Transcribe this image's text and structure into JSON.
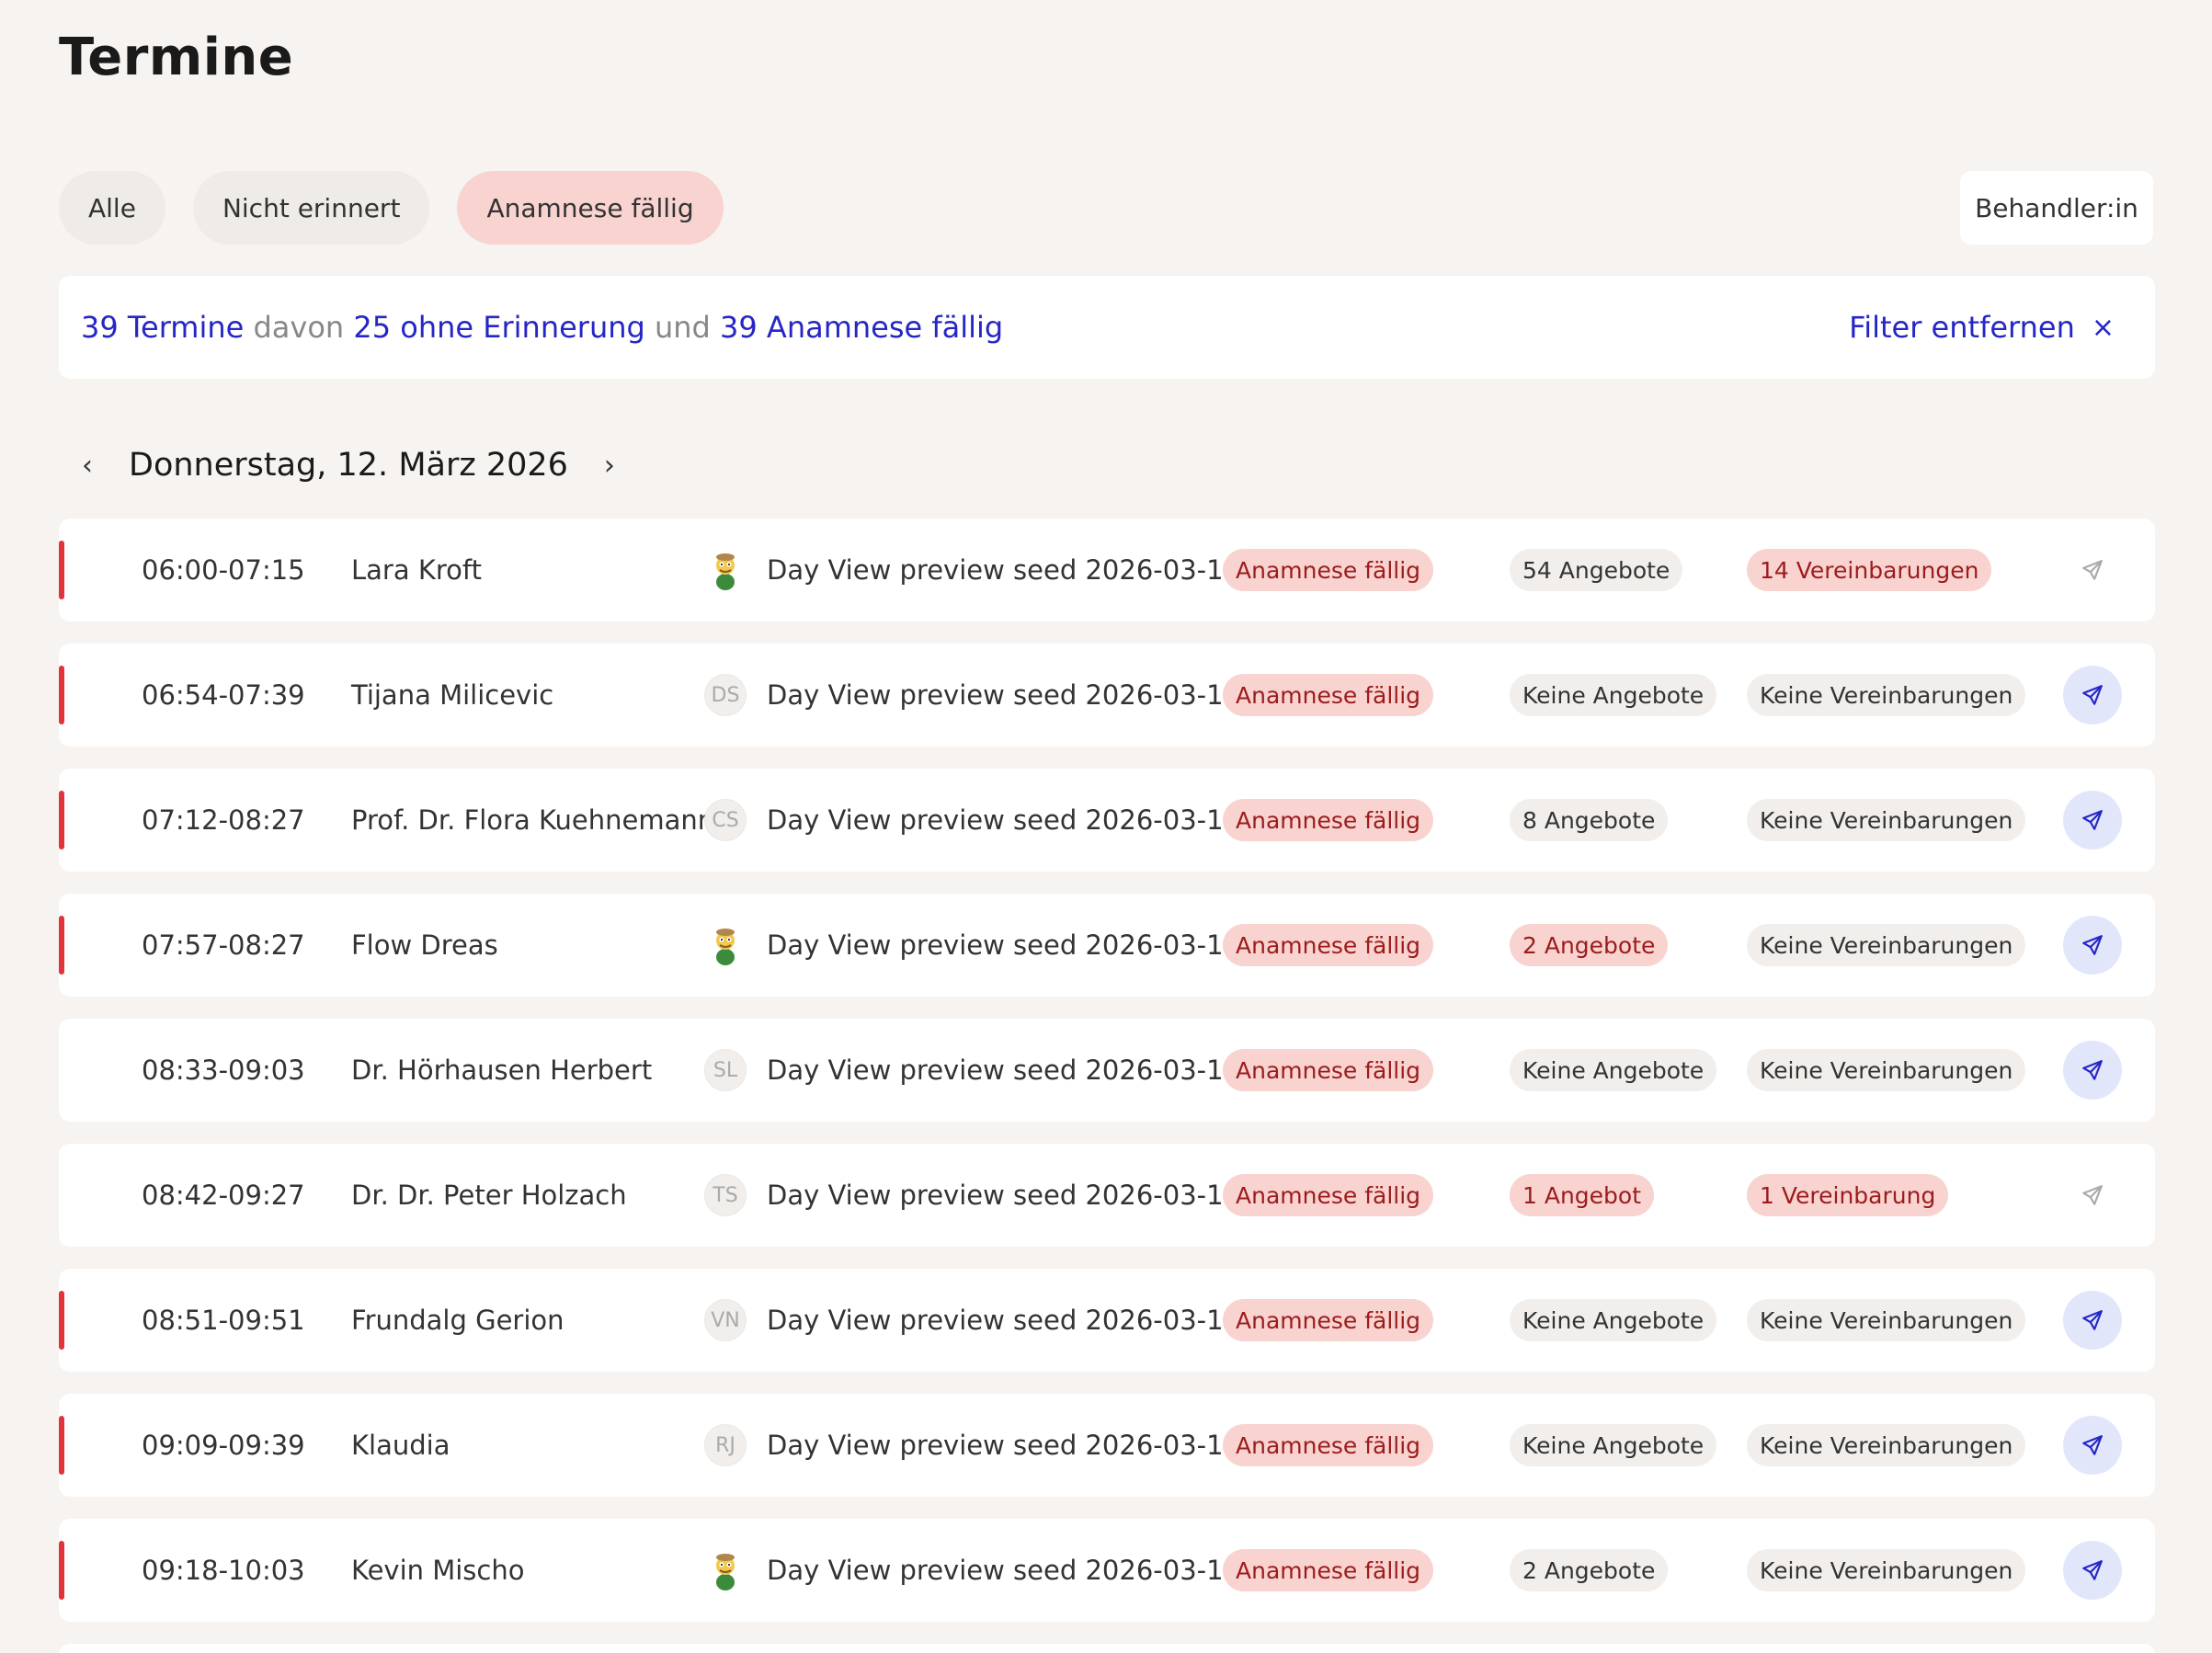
{
  "page": {
    "title": "Termine"
  },
  "filters": [
    {
      "label": "Alle",
      "active": false
    },
    {
      "label": "Nicht erinnert",
      "active": false
    },
    {
      "label": "Anamnese fällig",
      "active": true
    }
  ],
  "behandler": {
    "label": "Behandler:in"
  },
  "summary": {
    "termine": "39 Termine",
    "davon": "davon",
    "ohne_erinnerung": "25 ohne Erinnerung",
    "und": "und",
    "anamnese": "39 Anamnese fällig",
    "filter_remove": "Filter entfernen",
    "close_glyph": "×"
  },
  "date_nav": {
    "prev": "‹",
    "date": "Donnerstag, 12. März 2026",
    "next": "›"
  },
  "colors": {
    "accent": "#2626c7",
    "alert": "#e0333b",
    "badge_red_bg": "#f8d3d0"
  },
  "appointments": [
    {
      "time": "06:00-07:15",
      "name": "Lara Kroft",
      "avatar": "",
      "avatar_icon": "cartoon-avatar-icon",
      "desc": "Day View preview seed 2026-03-1...",
      "anamnese": "Anamnese fällig",
      "angebote": "54 Angebote",
      "angebote_alert": false,
      "vereinbarungen": "14 Vereinbarungen",
      "vereinbarungen_alert": true,
      "send_active": false,
      "flag": true
    },
    {
      "time": "06:54-07:39",
      "name": "Tijana Milicevic",
      "avatar": "DS",
      "desc": "Day View preview seed 2026-03-1...",
      "anamnese": "Anamnese fällig",
      "angebote": "Keine Angebote",
      "angebote_alert": false,
      "vereinbarungen": "Keine Vereinbarungen",
      "vereinbarungen_alert": false,
      "send_active": true,
      "flag": true
    },
    {
      "time": "07:12-08:27",
      "name": "Prof. Dr. Flora Kuehnemann",
      "avatar": "CS",
      "desc": "Day View preview seed 2026-03-1...",
      "anamnese": "Anamnese fällig",
      "angebote": "8 Angebote",
      "angebote_alert": false,
      "vereinbarungen": "Keine Vereinbarungen",
      "vereinbarungen_alert": false,
      "send_active": true,
      "flag": true
    },
    {
      "time": "07:57-08:27",
      "name": "Flow Dreas",
      "avatar": "",
      "avatar_icon": "cartoon-avatar-icon",
      "desc": "Day View preview seed 2026-03-1...",
      "anamnese": "Anamnese fällig",
      "angebote": "2 Angebote",
      "angebote_alert": true,
      "vereinbarungen": "Keine Vereinbarungen",
      "vereinbarungen_alert": false,
      "send_active": true,
      "flag": true
    },
    {
      "time": "08:33-09:03",
      "name": "Dr. Hörhausen Herbert",
      "avatar": "SL",
      "desc": "Day View preview seed 2026-03-1...",
      "anamnese": "Anamnese fällig",
      "angebote": "Keine Angebote",
      "angebote_alert": false,
      "vereinbarungen": "Keine Vereinbarungen",
      "vereinbarungen_alert": false,
      "send_active": true,
      "flag": false
    },
    {
      "time": "08:42-09:27",
      "name": "Dr. Dr. Peter Holzach",
      "avatar": "TS",
      "desc": "Day View preview seed 2026-03-1...",
      "anamnese": "Anamnese fällig",
      "angebote": "1 Angebot",
      "angebote_alert": true,
      "vereinbarungen": "1 Vereinbarung",
      "vereinbarungen_alert": true,
      "send_active": false,
      "flag": false
    },
    {
      "time": "08:51-09:51",
      "name": "Frundalg Gerion",
      "avatar": "VN",
      "desc": "Day View preview seed 2026-03-1...",
      "anamnese": "Anamnese fällig",
      "angebote": "Keine Angebote",
      "angebote_alert": false,
      "vereinbarungen": "Keine Vereinbarungen",
      "vereinbarungen_alert": false,
      "send_active": true,
      "flag": true
    },
    {
      "time": "09:09-09:39",
      "name": "Klaudia",
      "avatar": "RJ",
      "desc": "Day View preview seed 2026-03-1...",
      "anamnese": "Anamnese fällig",
      "angebote": "Keine Angebote",
      "angebote_alert": false,
      "vereinbarungen": "Keine Vereinbarungen",
      "vereinbarungen_alert": false,
      "send_active": true,
      "flag": true
    },
    {
      "time": "09:18-10:03",
      "name": "Kevin Mischo",
      "avatar": "",
      "avatar_icon": "cartoon-avatar-icon",
      "desc": "Day View preview seed 2026-03-1...",
      "anamnese": "Anamnese fällig",
      "angebote": "2 Angebote",
      "angebote_alert": false,
      "vereinbarungen": "Keine Vereinbarungen",
      "vereinbarungen_alert": false,
      "send_active": true,
      "flag": true
    }
  ]
}
